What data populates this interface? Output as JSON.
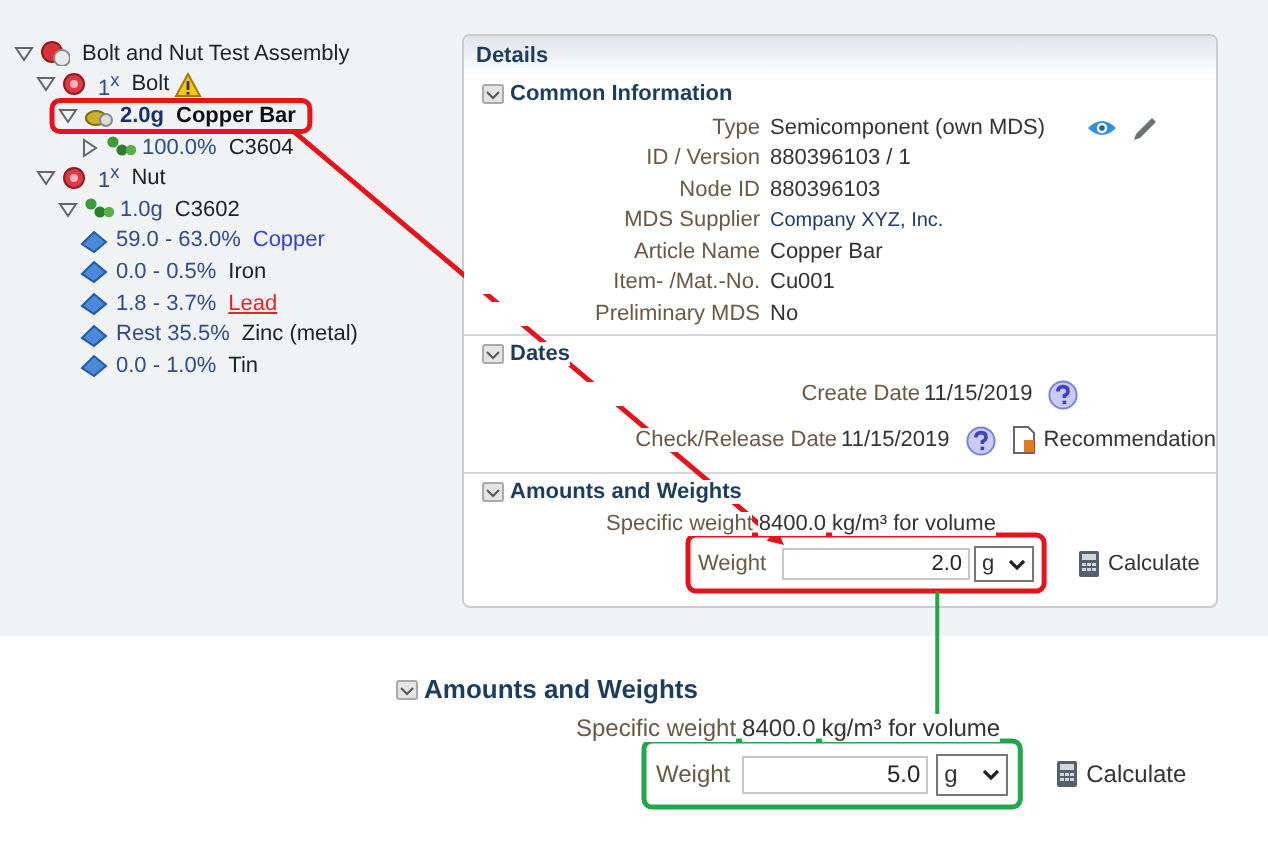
{
  "tree": {
    "items": [
      {
        "kind": "assembly",
        "name": "Bolt and Nut Test Assembly",
        "expanded": true,
        "selected": false,
        "warning": false,
        "children": [
          {
            "kind": "part",
            "amount": "1$^{x}$",
            "name": "Bolt",
            "expanded": true,
            "selected": false,
            "warning": true,
            "children": [
              {
                "kind": "semicomponent",
                "amount": "2.0g",
                "name": "Copper Bar",
                "expanded": true,
                "selected": true,
                "warning": false,
                "children": [
                  {
                    "kind": "material",
                    "amount": "100.0%",
                    "name": "C3604",
                    "expanded": false,
                    "selected": false,
                    "warning": false
                  }
                ]
              }
            ]
          },
          {
            "kind": "part",
            "amount": "1$^{x}$",
            "name": "Nut",
            "expanded": true,
            "selected": false,
            "warning": false,
            "children": [
              {
                "kind": "material",
                "amount": "1.0g",
                "name": "C3602",
                "expanded": true,
                "selected": false,
                "warning": false,
                "children": [
                  {
                    "kind": "linked-substance",
                    "amount": "59.0 - 63.0%",
                    "name": "Copper",
                    "selected": false,
                    "warning": false
                  },
                  {
                    "kind": "substance",
                    "amount": "0.0 - 0.5%",
                    "name": "Iron",
                    "selected": false,
                    "warning": false
                  },
                  {
                    "kind": "flagged-substance",
                    "amount": "1.8 - 3.7%",
                    "name": "Lead",
                    "selected": false,
                    "warning": false
                  },
                  {
                    "kind": "substance",
                    "amount": "Rest 35.5%",
                    "name": "Zinc (metal)",
                    "selected": false,
                    "warning": false
                  },
                  {
                    "kind": "substance",
                    "amount": "0.0 - 1.0%",
                    "name": "Tin",
                    "selected": false,
                    "warning": false
                  }
                ]
              }
            ]
          }
        ]
      }
    ]
  },
  "details": {
    "title": "Details",
    "sections": [
      {
        "kind": "fields",
        "title": "Common Information",
        "fields": [
          {
            "kind": "type",
            "label": "Type",
            "value": "Semicomponent (own MDS)"
          },
          {
            "kind": "text",
            "label": "ID / Version",
            "value": "880396103 / 1"
          },
          {
            "kind": "text",
            "label": "Node ID",
            "value": "880396103"
          },
          {
            "kind": "supplier",
            "label": "MDS Supplier",
            "value": "Company XYZ, Inc."
          },
          {
            "kind": "text",
            "label": "Article Name",
            "value": "Copper Bar"
          },
          {
            "kind": "text",
            "label": "Item- /Mat.-No.",
            "value": "Cu001"
          },
          {
            "kind": "text",
            "label": "Preliminary MDS",
            "value": "No"
          }
        ]
      },
      {
        "kind": "dates",
        "title": "Dates",
        "fields": [
          {
            "kind": "date",
            "label": "Create Date",
            "value": "11/15/2019"
          },
          {
            "kind": "date",
            "label": "Check/Release Date",
            "value": "11/15/2019",
            "extra": "Recommendation"
          }
        ]
      },
      {
        "kind": "amounts",
        "title": "Amounts and Weights",
        "specific_label": "Specific weight",
        "specific_value": "8400.0",
        "specific_unit": "kg/m³ for volume",
        "weight_label": "Weight",
        "weight_value": "2.0",
        "unit": "g",
        "calculate": "Calculate"
      }
    ]
  },
  "zoom_view": {
    "kind": "amounts",
    "title": "Amounts and Weights",
    "specific_label": "Specific weight",
    "specific_value": "8400.0",
    "specific_unit": "kg/m³ for volume",
    "weight_label": "Weight",
    "weight_value": "5.0",
    "unit": "g",
    "calculate": "Calculate"
  },
  "callouts": [
    {
      "color": "#e5141c"
    },
    {
      "color": "#21a64b"
    }
  ]
}
